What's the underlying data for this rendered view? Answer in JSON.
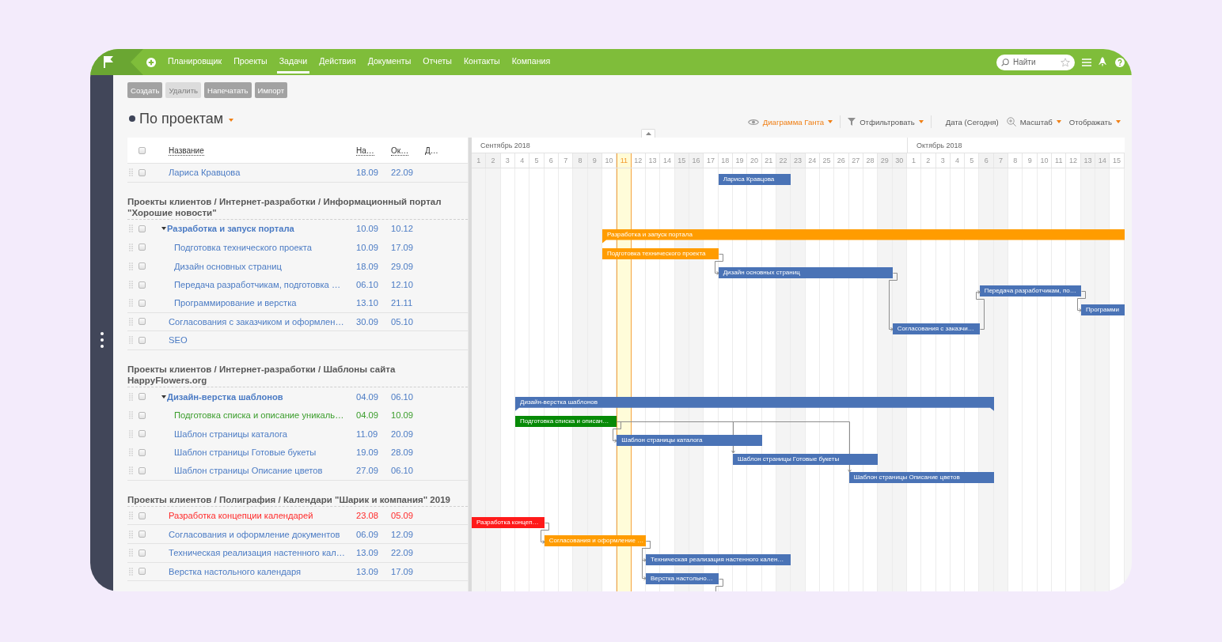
{
  "nav": {
    "items": [
      {
        "label": "Планировщик",
        "selected": false
      },
      {
        "label": "Проекты",
        "selected": false
      },
      {
        "label": "Задачи",
        "selected": true
      },
      {
        "label": "Действия",
        "selected": false
      },
      {
        "label": "Документы",
        "selected": false
      },
      {
        "label": "Отчеты",
        "selected": false
      },
      {
        "label": "Контакты",
        "selected": false
      },
      {
        "label": "Компания",
        "selected": false
      }
    ]
  },
  "search": {
    "placeholder": "Найти"
  },
  "toolbar": {
    "buttons": [
      {
        "label": "Создать",
        "disabled": false
      },
      {
        "label": "Удалить",
        "disabled": true
      },
      {
        "label": "Напечатать",
        "disabled": false
      },
      {
        "label": "Импорт",
        "disabled": false
      }
    ]
  },
  "view": {
    "title": "По проектам",
    "title_dropdown": true,
    "control_groups": [
      {
        "controls": [
          {
            "kind": "view",
            "label": "Диаграмма Ганта",
            "active": true,
            "dropdown": true
          }
        ]
      },
      {
        "controls": [
          {
            "kind": "filter",
            "label": "Отфильтровать",
            "active": false,
            "dropdown": true
          }
        ]
      },
      {
        "controls": [
          {
            "kind": "date",
            "label": "Дата (Сегодня)",
            "active": false,
            "dropdown": false
          },
          {
            "kind": "zoom",
            "label": "Масштаб",
            "active": false,
            "dropdown": true
          },
          {
            "kind": "display",
            "label": "Отображать",
            "active": false,
            "dropdown": true
          }
        ]
      }
    ]
  },
  "table": {
    "header_checkbox": {
      "checked": false
    },
    "columns": [
      {
        "label": "Название",
        "sortable": true
      },
      {
        "label": "На…",
        "sortable": true
      },
      {
        "label": "Ок…",
        "sortable": true
      },
      {
        "label": "Д…",
        "sortable": false
      }
    ],
    "groups": [
      {
        "tasks": [
          {
            "name": "Лариса Кравцова",
            "start": "18.09",
            "end": "22.09",
            "checked": false,
            "color": "#4b7bc4",
            "bar": {
              "kind": "task",
              "label": "Лариса Кравцова",
              "color": "#4a73b6"
            }
          }
        ]
      },
      {
        "title": "Проекты клиентов / Интернет-разработки / Информационный портал \"Хорошие новости\"",
        "tasks": [
          {
            "name": "Разработка и запуск портала",
            "start": "10.09",
            "end": "10.12",
            "checked": false,
            "color": "#4b7bc4",
            "expanded": true,
            "bar": {
              "kind": "summary",
              "label": "Разработка и запуск портала",
              "color": "#ff9c00"
            },
            "children": [
              {
                "name": "Подготовка технического проекта",
                "start": "10.09",
                "end": "17.09",
                "checked": false,
                "color": "#4b7bc4",
                "bar": {
                  "kind": "task",
                  "label": "Подготовка технического проекта",
                  "color": "#ff9c00"
                }
              },
              {
                "name": "Дизайн основных страниц",
                "start": "18.09",
                "end": "29.09",
                "checked": false,
                "color": "#4b7bc4",
                "bar": {
                  "kind": "task",
                  "label": "Дизайн основных страниц",
                  "color": "#4a73b6"
                }
              },
              {
                "name": "Передача разработчикам, подготовка …",
                "start": "06.10",
                "end": "12.10",
                "checked": false,
                "color": "#4b7bc4",
                "bar": {
                  "kind": "task",
                  "label": "Передача разработчикам, по…",
                  "color": "#4a73b6"
                }
              },
              {
                "name": "Программирование и верстка",
                "start": "13.10",
                "end": "21.11",
                "checked": false,
                "color": "#4b7bc4",
                "bar": {
                  "kind": "task",
                  "label": "Программи",
                  "color": "#4a73b6"
                }
              }
            ]
          },
          {
            "name": "Согласования с заказчиком и оформлен…",
            "start": "30.09",
            "end": "05.10",
            "checked": false,
            "color": "#4b7bc4",
            "bar": {
              "kind": "task",
              "label": "Согласования с заказчи…",
              "color": "#4a73b6"
            }
          },
          {
            "name": "SEO",
            "checked": false,
            "color": "#4b7bc4"
          }
        ]
      },
      {
        "title": "Проекты клиентов / Интернет-разработки / Шаблоны сайта HappyFlowers.org",
        "tasks": [
          {
            "name": "Дизайн-верстка шаблонов",
            "start": "04.09",
            "end": "06.10",
            "checked": false,
            "color": "#4b7bc4",
            "expanded": true,
            "bar": {
              "kind": "summary",
              "label": "Дизайн-верстка шаблонов",
              "color": "#4a73b6"
            },
            "children": [
              {
                "name": "Подготовка списка и описание уникаль…",
                "start": "04.09",
                "end": "10.09",
                "checked": false,
                "color": "#3a9d2b",
                "bar": {
                  "kind": "task",
                  "label": "Подготовка списка и описан…",
                  "color": "#078a07"
                }
              },
              {
                "name": "Шаблон страницы каталога",
                "start": "11.09",
                "end": "20.09",
                "checked": false,
                "color": "#4b7bc4",
                "bar": {
                  "kind": "task",
                  "label": "Шаблон страницы каталога",
                  "color": "#4a73b6"
                }
              },
              {
                "name": "Шаблон страницы Готовые букеты",
                "start": "19.09",
                "end": "28.09",
                "checked": false,
                "color": "#4b7bc4",
                "bar": {
                  "kind": "task",
                  "label": "Шаблон страницы Готовые букеты",
                  "color": "#4a73b6"
                }
              },
              {
                "name": "Шаблон страницы Описание цветов",
                "start": "27.09",
                "end": "06.10",
                "checked": false,
                "color": "#4b7bc4",
                "bar": {
                  "kind": "task",
                  "label": "Шаблон страницы Описание цветов",
                  "color": "#4a73b6"
                }
              }
            ]
          }
        ]
      },
      {
        "title": "Проекты клиентов / Полиграфия / Календари \"Шарик и компания\" 2019",
        "tasks": [
          {
            "name": "Разработка концепции календарей",
            "start": "23.08",
            "end": "05.09",
            "checked": false,
            "color": "#ff2b2b",
            "bar": {
              "kind": "task",
              "label": "Разработка концеп…",
              "color": "#ff1a1a"
            }
          },
          {
            "name": "Согласования и оформление документов",
            "start": "06.09",
            "end": "12.09",
            "checked": false,
            "color": "#4b7bc4",
            "bar": {
              "kind": "task",
              "label": "Согласования и оформление …",
              "color": "#ff9c00"
            }
          },
          {
            "name": "Техническая реализация настенного кал…",
            "start": "13.09",
            "end": "22.09",
            "checked": false,
            "color": "#4b7bc4",
            "bar": {
              "kind": "task",
              "label": "Техническая реализация настенного кален…",
              "color": "#4a73b6"
            }
          },
          {
            "name": "Верстка настольного календаря",
            "start": "13.09",
            "end": "17.09",
            "checked": false,
            "color": "#4b7bc4",
            "bar": {
              "kind": "task",
              "label": "Верстка настольно…",
              "color": "#4a73b6"
            }
          }
        ]
      }
    ]
  },
  "gantt": {
    "months": [
      {
        "label": "Сентябрь 2018",
        "days": [
          {
            "label": "1",
            "weekend": true,
            "today": false
          },
          {
            "label": "2",
            "weekend": true,
            "today": false
          },
          {
            "label": "3",
            "weekend": false,
            "today": false
          },
          {
            "label": "4",
            "weekend": false,
            "today": false
          },
          {
            "label": "5",
            "weekend": false,
            "today": false
          },
          {
            "label": "6",
            "weekend": false,
            "today": false
          },
          {
            "label": "7",
            "weekend": false,
            "today": false
          },
          {
            "label": "8",
            "weekend": true,
            "today": false
          },
          {
            "label": "9",
            "weekend": true,
            "today": false
          },
          {
            "label": "10",
            "weekend": false,
            "today": false
          },
          {
            "label": "11",
            "weekend": false,
            "today": true
          },
          {
            "label": "12",
            "weekend": false,
            "today": false
          },
          {
            "label": "13",
            "weekend": false,
            "today": false
          },
          {
            "label": "14",
            "weekend": false,
            "today": false
          },
          {
            "label": "15",
            "weekend": true,
            "today": false
          },
          {
            "label": "16",
            "weekend": true,
            "today": false
          },
          {
            "label": "17",
            "weekend": false,
            "today": false
          },
          {
            "label": "18",
            "weekend": false,
            "today": false
          },
          {
            "label": "19",
            "weekend": false,
            "today": false
          },
          {
            "label": "20",
            "weekend": false,
            "today": false
          },
          {
            "label": "21",
            "weekend": false,
            "today": false
          },
          {
            "label": "22",
            "weekend": true,
            "today": false
          },
          {
            "label": "23",
            "weekend": true,
            "today": false
          },
          {
            "label": "24",
            "weekend": false,
            "today": false
          },
          {
            "label": "25",
            "weekend": false,
            "today": false
          },
          {
            "label": "26",
            "weekend": false,
            "today": false
          },
          {
            "label": "27",
            "weekend": false,
            "today": false
          },
          {
            "label": "28",
            "weekend": false,
            "today": false
          },
          {
            "label": "29",
            "weekend": true,
            "today": false
          },
          {
            "label": "30",
            "weekend": true,
            "today": false
          }
        ]
      },
      {
        "label": "Октябрь 2018",
        "days": [
          {
            "label": "1",
            "weekend": false,
            "today": false
          },
          {
            "label": "2",
            "weekend": false,
            "today": false
          },
          {
            "label": "3",
            "weekend": false,
            "today": false
          },
          {
            "label": "4",
            "weekend": false,
            "today": false
          },
          {
            "label": "5",
            "weekend": false,
            "today": false
          },
          {
            "label": "6",
            "weekend": true,
            "today": false
          },
          {
            "label": "7",
            "weekend": true,
            "today": false
          },
          {
            "label": "8",
            "weekend": false,
            "today": false
          },
          {
            "label": "9",
            "weekend": false,
            "today": false
          },
          {
            "label": "10",
            "weekend": false,
            "today": false
          },
          {
            "label": "11",
            "weekend": false,
            "today": false
          },
          {
            "label": "12",
            "weekend": false,
            "today": false
          },
          {
            "label": "13",
            "weekend": true,
            "today": false
          },
          {
            "label": "14",
            "weekend": true,
            "today": false
          },
          {
            "label": "15",
            "weekend": false,
            "today": false
          }
        ]
      }
    ]
  }
}
